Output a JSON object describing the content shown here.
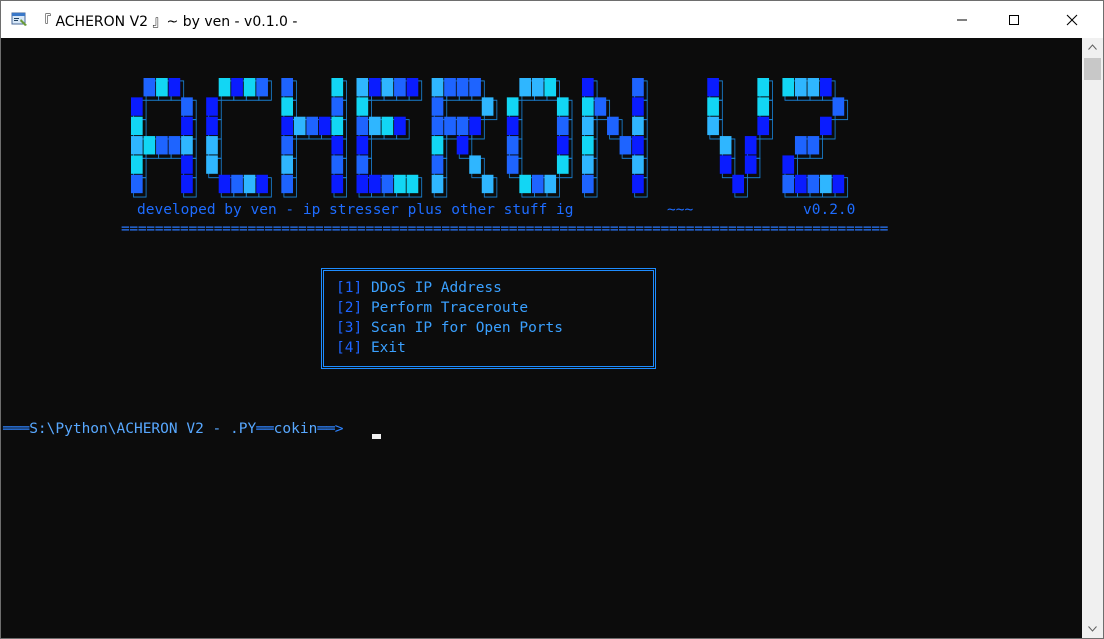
{
  "window": {
    "title": "『 ACHERON V2 』~ by ven - v0.1.0 -"
  },
  "banner": {
    "logo_text": "ACHERON V2",
    "tagline": "developed by ven - ip stresser plus other stuff ig",
    "tag_mid": "~~~",
    "version": "v0.2.0",
    "divider": "==========================================================================================="
  },
  "menu": {
    "items": [
      {
        "num": "[1]",
        "label": "DDoS IP Address"
      },
      {
        "num": "[2]",
        "label": "Perform Traceroute"
      },
      {
        "num": "[3]",
        "label": "Scan IP for Open Ports"
      },
      {
        "num": "[4]",
        "label": "Exit"
      }
    ]
  },
  "prompt": {
    "prefix": "═══",
    "path": "S:\\Python\\ACHERON V2 - .PY",
    "sep": "══",
    "user": "cokin",
    "arrow": "══>"
  },
  "colors": {
    "deep_blue": "#0a1cff",
    "mid_blue": "#1e64ff",
    "cyan": "#12d6f4",
    "sky": "#2fb6ff",
    "background": "#0c0c0c"
  }
}
